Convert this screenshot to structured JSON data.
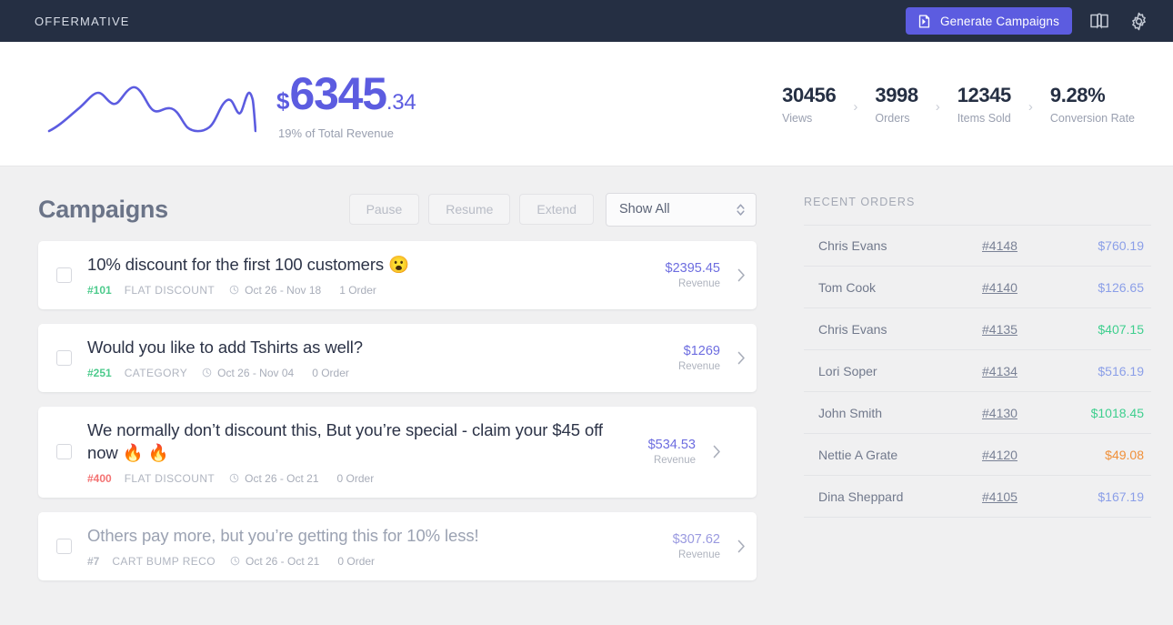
{
  "topbar": {
    "brand": "OFFERMATIVE",
    "generate_button": "Generate Campaigns",
    "generate_icon": "document-page-icon",
    "book_icon": "book-icon",
    "gear_icon": "gear-icon"
  },
  "hero": {
    "currency": "$",
    "amount": "6345",
    "decimal": ".34",
    "subtitle": "19% of Total Revenue",
    "accent_color": "#5c5ce0",
    "kpis": [
      {
        "value": "30456",
        "label": "Views"
      },
      {
        "value": "3998",
        "label": "Orders"
      },
      {
        "value": "12345",
        "label": "Items Sold"
      },
      {
        "value": "9.28%",
        "label": "Conversion Rate"
      }
    ]
  },
  "campaigns": {
    "title": "Campaigns",
    "buttons": [
      "Pause",
      "Resume",
      "Extend"
    ],
    "filter": {
      "value": "Show All",
      "icon": "chevron-up-down-icon"
    },
    "items": [
      {
        "title": "10% discount for the first 100 customers 😮",
        "id": "#101",
        "id_color": "#4ecb8d",
        "type": "FLAT DISCOUNT",
        "date": "Oct 26 - Nov 18",
        "orders": "1 Order",
        "revenue": "$2395.45",
        "revenue_label": "Revenue",
        "muted": false
      },
      {
        "title": "Would you like to add Tshirts as well?",
        "id": "#251",
        "id_color": "#4ecb8d",
        "type": "CATEGORY",
        "date": "Oct 26 - Nov 04",
        "orders": "0 Order",
        "revenue": "$1269",
        "revenue_label": "Revenue",
        "muted": false
      },
      {
        "title": "We normally don’t discount this, But you’re special - claim your $45 off now 🔥 🔥",
        "id": "#400",
        "id_color": "#f37272",
        "type": "FLAT DISCOUNT",
        "date": "Oct 26 - Oct 21",
        "orders": "0 Order",
        "revenue": "$534.53",
        "revenue_label": "Revenue",
        "muted": false
      },
      {
        "title": "Others pay more, but you’re getting this for 10% less!",
        "id": "#7",
        "id_color": "#b5bac4",
        "type": "CART BUMP RECO",
        "date": "Oct 26 - Oct 21",
        "orders": "0 Order",
        "revenue": "$307.62",
        "revenue_label": "Revenue",
        "muted": true
      }
    ]
  },
  "recent_orders": {
    "title": "RECENT ORDERS",
    "rows": [
      {
        "name": "Chris Evans",
        "order": "#4148",
        "amount": "$760.19",
        "amount_color": "#8b9fe8"
      },
      {
        "name": "Tom Cook",
        "order": "#4140",
        "amount": "$126.65",
        "amount_color": "#8b9fe8"
      },
      {
        "name": "Chris Evans",
        "order": "#4135",
        "amount": "$407.15",
        "amount_color": "#3ecf8e"
      },
      {
        "name": "Lori Soper",
        "order": "#4134",
        "amount": "$516.19",
        "amount_color": "#8b9fe8"
      },
      {
        "name": "John Smith",
        "order": "#4130",
        "amount": "$1018.45",
        "amount_color": "#3ecf8e"
      },
      {
        "name": "Nettie A Grate",
        "order": "#4120",
        "amount": "$49.08",
        "amount_color": "#f0903a"
      },
      {
        "name": "Dina Sheppard",
        "order": "#4105",
        "amount": "$167.19",
        "amount_color": "#8b9fe8"
      }
    ]
  },
  "chart_data": {
    "type": "line",
    "title": "",
    "xlabel": "",
    "ylabel": "",
    "x": [
      0,
      1,
      2,
      3,
      4,
      5,
      6,
      7,
      8,
      9,
      10,
      11,
      12,
      13,
      14
    ],
    "values": [
      8,
      22,
      40,
      52,
      40,
      56,
      38,
      34,
      36,
      20,
      14,
      16,
      40,
      26,
      48
    ],
    "grid": false,
    "legend": "none",
    "line_color": "#5c5ce0"
  }
}
